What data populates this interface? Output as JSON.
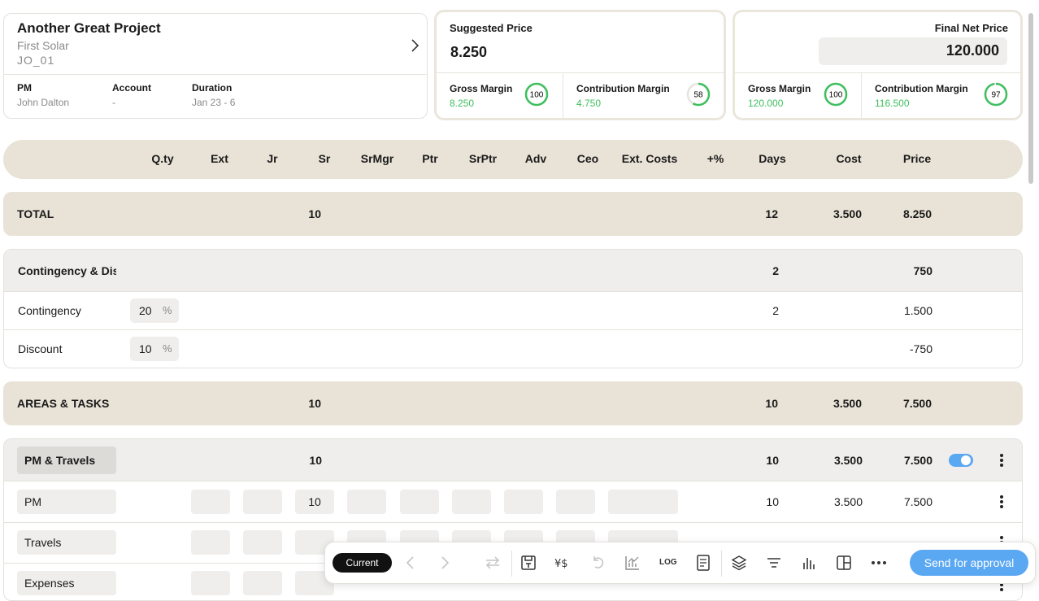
{
  "project": {
    "title": "Another Great Project",
    "client": "First Solar",
    "code": "JO_01",
    "meta": [
      {
        "key": "PM",
        "value": "John Dalton"
      },
      {
        "key": "Account",
        "value": "-"
      },
      {
        "key": "Duration",
        "value": "Jan 23 - 6"
      }
    ]
  },
  "suggested": {
    "label": "Suggested Price",
    "value": "8.250",
    "gross": {
      "label": "Gross Margin",
      "value": "8.250",
      "score": "100",
      "pct": 1.0
    },
    "contribution": {
      "label": "Contribution Margin",
      "value": "4.750",
      "score": "58",
      "pct": 0.58
    }
  },
  "final": {
    "label": "Final Net Price",
    "value": "120.000",
    "gross": {
      "label": "Gross Margin",
      "value": "120.000",
      "score": "100",
      "pct": 1.0
    },
    "contribution": {
      "label": "Contribution Margin",
      "value": "116.500",
      "score": "97",
      "pct": 0.97
    }
  },
  "columns": [
    "Q.ty",
    "Ext",
    "Jr",
    "Sr",
    "SrMgr",
    "Ptr",
    "SrPtr",
    "Adv",
    "Ceo",
    "Ext. Costs",
    "+%",
    "Days",
    "Cost",
    "Price"
  ],
  "total": {
    "label": "TOTAL",
    "sr": "10",
    "days": "12",
    "cost": "3.500",
    "price": "8.250"
  },
  "contingency": {
    "label": "Contingency & Dis",
    "days": "2",
    "price": "750",
    "rows": [
      {
        "label": "Contingency",
        "pct": "20",
        "unit": "%",
        "days": "2",
        "price": "1.500"
      },
      {
        "label": "Discount",
        "pct": "10",
        "unit": "%",
        "days": "",
        "price": "-750"
      }
    ]
  },
  "areas": {
    "label": "AREAS & TASKS",
    "sr": "10",
    "days": "10",
    "cost": "3.500",
    "price": "7.500"
  },
  "pm_travels": {
    "label": "PM & Travels",
    "sr": "10",
    "days": "10",
    "cost": "3.500",
    "price": "7.500",
    "rows": [
      {
        "label": "PM",
        "sr": "10",
        "days": "10",
        "cost": "3.500",
        "price": "7.500"
      },
      {
        "label": "Travels"
      },
      {
        "label": "Expenses"
      }
    ]
  },
  "toolbar": {
    "current": "Current",
    "log": "LOG",
    "send": "Send for approval"
  },
  "colors": {
    "accent": "#5aa7f2",
    "band": "#e9e3d7",
    "good": "#3fbf5f"
  }
}
